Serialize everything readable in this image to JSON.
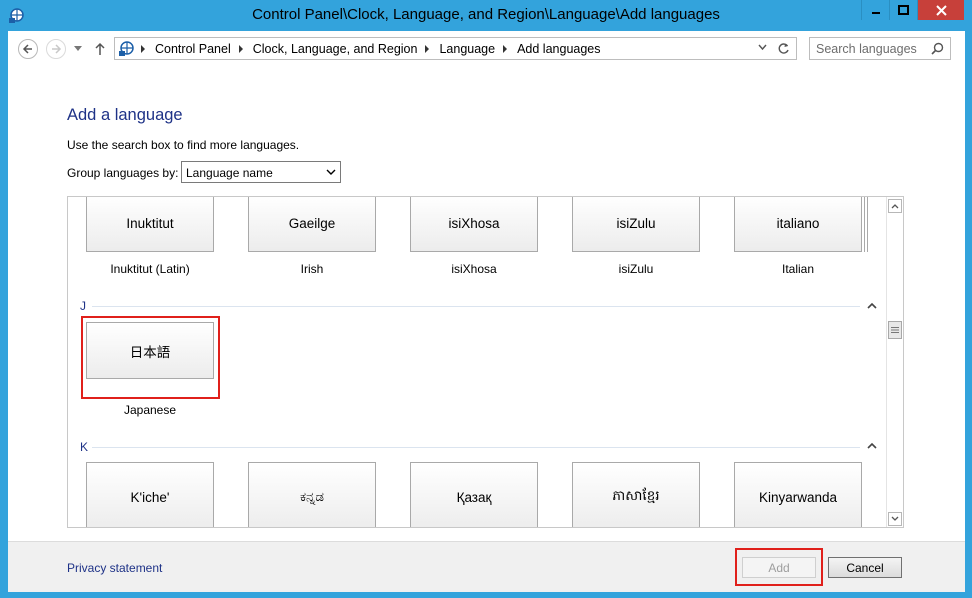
{
  "window": {
    "title": "Control Panel\\Clock, Language, and Region\\Language\\Add languages"
  },
  "address_bar": {
    "crumbs": [
      "Control Panel",
      "Clock, Language, and Region",
      "Language",
      "Add languages"
    ]
  },
  "search": {
    "placeholder": "Search languages"
  },
  "content": {
    "heading": "Add a language",
    "hint": "Use the search box to find more languages.",
    "group_label": "Group languages by:",
    "group_value": "Language name"
  },
  "languages": {
    "row_i": [
      {
        "native": "Inuktitut",
        "label": "Inuktitut (Latin)"
      },
      {
        "native": "Gaeilge",
        "label": "Irish"
      },
      {
        "native": "isiXhosa",
        "label": "isiXhosa"
      },
      {
        "native": "isiZulu",
        "label": "isiZulu"
      },
      {
        "native": "italiano",
        "label": "Italian"
      }
    ],
    "group_j": "J",
    "row_j": [
      {
        "native": "日本語",
        "label": "Japanese"
      }
    ],
    "group_k": "K",
    "row_k": [
      {
        "native": "K'iche'"
      },
      {
        "native": "ಕನ್ನಡ"
      },
      {
        "native": "Қазақ"
      },
      {
        "native": "ភាសាខ្មែរ"
      },
      {
        "native": "Kinyarwanda"
      }
    ]
  },
  "footer": {
    "privacy": "Privacy statement",
    "add": "Add",
    "cancel": "Cancel"
  },
  "colors": {
    "frame": "#33a3dc",
    "close": "#c7403a",
    "link": "#1e3287",
    "highlight": "#e0201b"
  }
}
